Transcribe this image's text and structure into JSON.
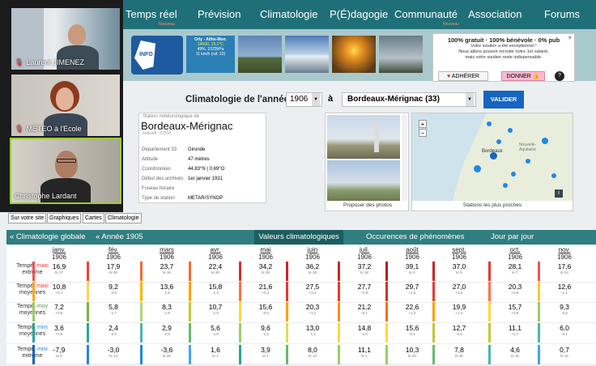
{
  "participants": [
    {
      "name": "Laurent JIMENEZ"
    },
    {
      "name": "METEO à l'Ecole"
    },
    {
      "name": "Christophe Lardant"
    }
  ],
  "nav": {
    "items": [
      "Temps réel",
      "Prévision",
      "Climatologie",
      "P(É)dagogie",
      "Communauté",
      "Association",
      "Forums"
    ],
    "badge_tr": "Nouveau",
    "badge_comm": "Nouveau"
  },
  "banner": {
    "logo_text": "INFO CLIMAT",
    "weather": {
      "place": "Orly - Athis-Mon.",
      "time": "14h00, 15,1°C",
      "humidity": "49%, 1023hPa",
      "wind": "11 km/h (raf. 32)"
    },
    "support": {
      "title": "100% gratuit · 100% bénévole · 0% pub",
      "line1": "Votre soutien a été exceptionnel !",
      "line2": "Nous allons pouvoir recruter notre 1er salarié,",
      "line3": "mais votre soutien reste indispensable.",
      "adherer": "ADHÉRER",
      "donner": "DONNER",
      "help": "?",
      "close": "×"
    }
  },
  "left_tabs": [
    "Sur votre site",
    "Graphiques",
    "Cartes",
    "Climatologie"
  ],
  "clim": {
    "label": "Climatologie de l'année",
    "year": "1906",
    "a": "à",
    "station": "Bordeaux-Mérignac (33)",
    "validate": "VALIDER"
  },
  "station": {
    "caption": "Station météorologique de",
    "name": "Bordeaux-Mérignac",
    "id": "Indicatif : 07510",
    "rows": [
      {
        "label": "Département 33",
        "value": "Gironde"
      },
      {
        "label": "Altitude",
        "value": "47 mètres"
      },
      {
        "label": "Coordonnées",
        "value": "44,83°N | 0,69°O"
      },
      {
        "label": "Début des archives",
        "value": "1er janvier 1931"
      },
      {
        "label": "Fuseau horaire",
        "value": ""
      },
      {
        "label": "Type de station",
        "value": "METAR/SYNOP"
      }
    ]
  },
  "photos": {
    "caption": "Proposer des photos"
  },
  "map": {
    "caption": "Stations les plus proches",
    "city": "Bordeaux",
    "region": "Nouvelle-Aquitaine",
    "info": "i"
  },
  "table_tabs": [
    "« Climatologie globale",
    "« Année 1905",
    "Valeurs climatologiques",
    "Occurences de phénomènes",
    "Jour par jour"
  ],
  "months": [
    "janv.",
    "fév.",
    "mars",
    "avr.",
    "mai",
    "juin",
    "juil.",
    "août",
    "sept.",
    "oct.",
    "nov."
  ],
  "year": "1906",
  "rows": [
    {
      "label_a": "Tempé.",
      "label_b": "maxi",
      "label_c": "extrême",
      "label_color": "#e53935",
      "values": [
        "16,9",
        "17,9",
        "23,7",
        "22,4",
        "34,2",
        "36,2",
        "37,2",
        "39,1",
        "37,0",
        "28,1",
        "17,6"
      ],
      "subs": [
        "le 17",
        "le 26",
        "le 18",
        "le 26",
        "le 29",
        "le 28",
        "le 18",
        "le 2",
        "le 5",
        "le 7",
        "le 24"
      ],
      "colors": [
        "#ef5350",
        "#f44336",
        "#ef6c2f",
        "#ef6c2f",
        "#d32f2f",
        "#c62828",
        "#c62828",
        "#b71c1c",
        "#c62828",
        "#e53935",
        "#ef5350"
      ]
    },
    {
      "label_a": "Tempé.",
      "label_b": "maxi",
      "label_c": "moyennes",
      "label_color": "#e53935",
      "values": [
        "10,8",
        "9,2",
        "13,6",
        "15,8",
        "21,6",
        "27,5",
        "27,7",
        "29,7",
        "27,0",
        "20,3",
        "12,6"
      ],
      "subs": [
        "+0,7",
        "-2,5",
        "-1,5",
        "-1,3",
        "+0,4",
        "+3,3",
        "+0,9",
        "+2,5",
        "+3,0",
        "+0,9",
        "-1,1"
      ],
      "colors": [
        "#f9a825",
        "#ffd54f",
        "#ffb300",
        "#ffa000",
        "#ff7043",
        "#e53935",
        "#e53935",
        "#d32f2f",
        "#e53935",
        "#ff7043",
        "#ffca28"
      ]
    },
    {
      "label_a": "Tempé.",
      "label_b": "moy",
      "label_c": "moyennes",
      "label_color": "#43a047",
      "values": [
        "7,2",
        "5,8",
        "8,3",
        "10,7",
        "15,6",
        "20,3",
        "21,2",
        "22,6",
        "19,9",
        "15,7",
        "9,3"
      ],
      "subs": [
        "+0,5",
        "-1,7",
        "-1,9",
        "-1,5",
        "-0,5",
        "+1,2",
        "-0,1",
        "+1,2",
        "+1,4",
        "+0,8",
        "-0,6"
      ],
      "colors": [
        "#9ccc65",
        "#7cb342",
        "#aed581",
        "#c0ca33",
        "#fdd835",
        "#ffa000",
        "#ff8f00",
        "#ff6f00",
        "#ffa000",
        "#fdd835",
        "#9ccc65"
      ]
    },
    {
      "label_a": "Tempé.",
      "label_b": "mini",
      "label_c": "moyennes",
      "label_color": "#1e88e5",
      "values": [
        "3,6",
        "2,4",
        "2,9",
        "5,6",
        "9,6",
        "13,0",
        "14,8",
        "15,6",
        "12,7",
        "11,1",
        "6,0"
      ],
      "subs": [
        "+0,5",
        "-0,9",
        "-2,5",
        "-1,8",
        "-1,5",
        "-1,1",
        "-1,0",
        "-0,1",
        "-0,2",
        "+2,7",
        "-0,1"
      ],
      "colors": [
        "#26a69a",
        "#26a69a",
        "#4db6ac",
        "#66bb6a",
        "#9ccc65",
        "#d4e157",
        "#fdd835",
        "#fdd835",
        "#c0ca33",
        "#c0ca33",
        "#4db6ac"
      ]
    },
    {
      "label_a": "Tempé.",
      "label_b": "mini",
      "label_c": "extrême",
      "label_color": "#1e88e5",
      "values": [
        "-7,9",
        "-3,0",
        "-3,6",
        "1,6",
        "3,9",
        "8,0",
        "11,1",
        "10,3",
        "7,8",
        "4,6",
        "0,7"
      ],
      "subs": [
        "le 5",
        "le 13",
        "le 25",
        "le 1",
        "le 1",
        "le 13",
        "le 1",
        "le 20",
        "le 20",
        "le 15",
        "le 12"
      ],
      "colors": [
        "#1565c0",
        "#1e88e5",
        "#1e88e5",
        "#42a5f5",
        "#26a69a",
        "#66bb6a",
        "#9ccc65",
        "#9ccc65",
        "#66bb6a",
        "#4db6ac",
        "#42a5f5"
      ]
    }
  ]
}
